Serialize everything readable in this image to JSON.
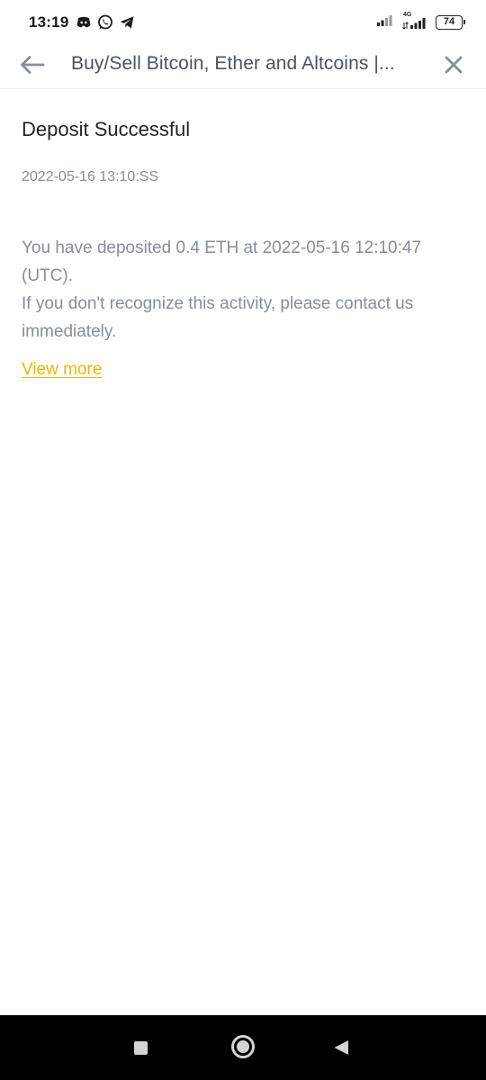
{
  "status_bar": {
    "time": "13:19",
    "battery": "74",
    "network": "4G",
    "left_icons": [
      "discord-icon",
      "whatsapp-icon",
      "telegram-icon"
    ],
    "right_icons": [
      "signal-icon",
      "signal-4g-icon",
      "battery-icon"
    ]
  },
  "toolbar": {
    "title": "Buy/Sell Bitcoin, Ether and Altcoins |...",
    "back_icon": "arrow-left-icon",
    "close_icon": "close-icon"
  },
  "notification": {
    "title": "Deposit Successful",
    "timestamp": "2022-05-16 13:10:SS",
    "message_line1": "You have deposited 0.4 ETH at 2022-05-16 12:10:47 (UTC).",
    "message_line2": "If you don't recognize this activity, please contact us immediately.",
    "link_label": "View more"
  },
  "nav_bar": {
    "buttons": [
      "recents-icon",
      "home-icon",
      "back-icon"
    ]
  },
  "colors": {
    "link": "#e8b70b",
    "title": "#1e2329",
    "muted": "#848e9c",
    "toolbar_text": "#4a5360"
  }
}
